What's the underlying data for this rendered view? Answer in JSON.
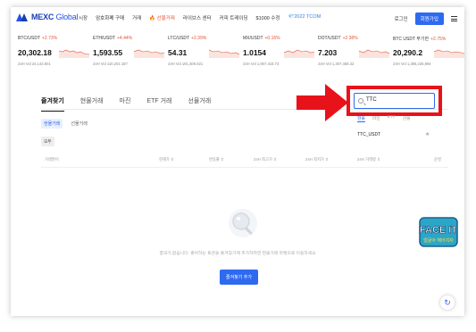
{
  "brand": {
    "name_bold": "MEXC",
    "name_light": " Global"
  },
  "nav": {
    "items": [
      "시장",
      "암호화폐 구매",
      "거래",
      "🔥 선물거래",
      "라이브스 센터",
      "커피 트레이딩",
      "$1000 수정",
      "💎2022 TCOM"
    ]
  },
  "header": {
    "login_label": "로그인",
    "signup_label": "회원가입"
  },
  "tickers": [
    {
      "pair": "BTC/USDT",
      "change": "+2.73%",
      "price": "20,302.18",
      "vol": "24H Vol 24,143.601"
    },
    {
      "pair": "ETH/USDT",
      "change": "+4.44%",
      "price": "1,593.55",
      "vol": "24H Vol 110,201.187"
    },
    {
      "pair": "LTC/USDT",
      "change": "+2.39%",
      "price": "54.31",
      "vol": "24H Vol 191,309.021"
    },
    {
      "pair": "MX/USDT",
      "change": "+0.16%",
      "price": "1.0154",
      "vol": "24H Vol 1,907,418.73"
    },
    {
      "pair": "DOT/USDT",
      "change": "+2.38%",
      "price": "7.203",
      "vol": "24H Vol 1,307,458.32"
    },
    {
      "pair": "BTC USDT 무기한",
      "change": "+2.75%",
      "price": "20,290.2",
      "vol": "24H Vol 1,386,236,994"
    }
  ],
  "tabs": [
    "즐겨찾기",
    "현물거래",
    "마진",
    "ETF 거래",
    "선물거래"
  ],
  "subtabs": [
    "현물거래",
    "선물거래"
  ],
  "chip_label": "모두",
  "table_headers": [
    "거래쌍이",
    "현재가 ⇕",
    "변동률 ⇕",
    "24H 최고가 ⇕",
    "24H 최저가 ⇕",
    "24H 거래량 ⇕",
    "운영"
  ],
  "empty": {
    "message": "결과가 없습니다. 좋아하는 토큰을 즐겨찾기에 추가하려면 현물거래 마켓으로 이동하세요",
    "button_label": "즐겨찾기 추가"
  },
  "search": {
    "value": "TTC",
    "tabs": [
      "현물",
      "마진",
      "ETF",
      "선물"
    ],
    "results": [
      "TTC_USDT"
    ]
  },
  "badge": {
    "line1": "FACE IT",
    "line2": "얼굴아 헤어지자"
  },
  "colors": {
    "accent": "#2e6af0",
    "positive": "#e0553a",
    "highlight": "#e8121a"
  }
}
